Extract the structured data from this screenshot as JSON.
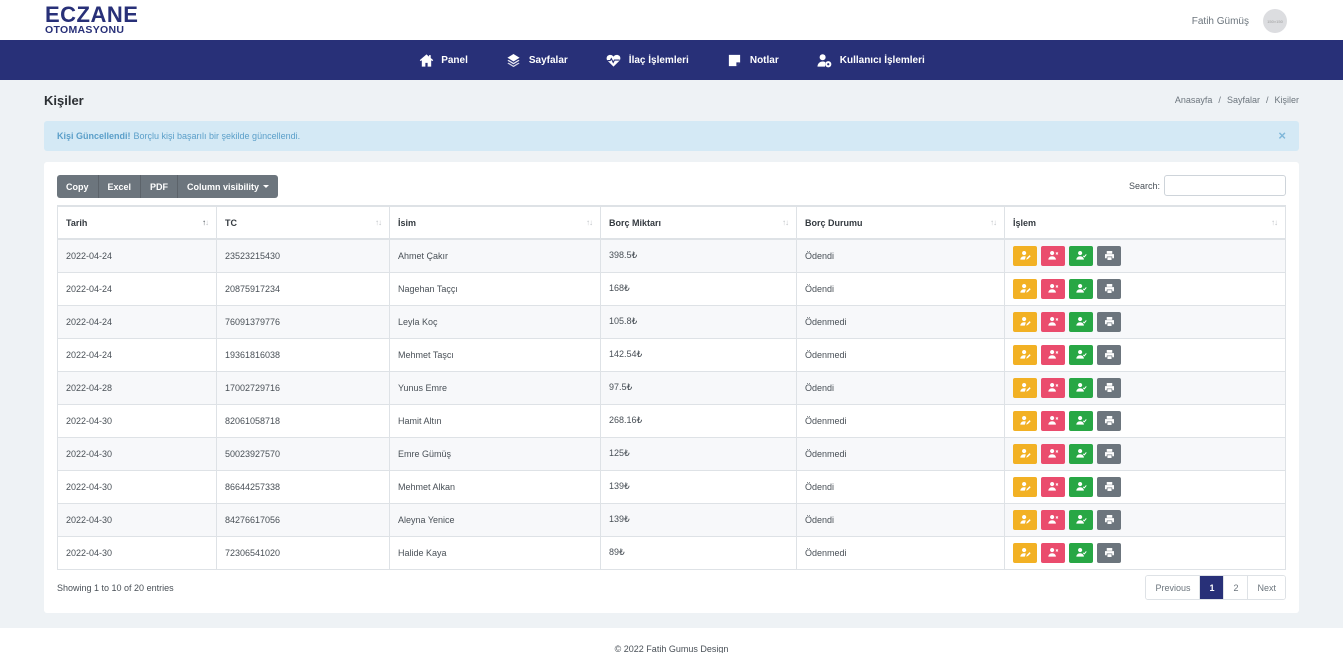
{
  "brand": {
    "name": "ECZANE",
    "subtitle": "OTOMASYONU",
    "color": "#283078"
  },
  "user": {
    "name": "Fatih Gümüş",
    "avatar_text": "150×150"
  },
  "nav": [
    {
      "label": "Panel",
      "icon": "home-icon"
    },
    {
      "label": "Sayfalar",
      "icon": "layers-icon"
    },
    {
      "label": "İlaç İşlemleri",
      "icon": "heart-pulse-icon"
    },
    {
      "label": "Notlar",
      "icon": "sticky-note-icon"
    },
    {
      "label": "Kullanıcı İşlemleri",
      "icon": "user-gear-icon"
    }
  ],
  "page": {
    "title": "Kişiler",
    "breadcrumb": [
      "Anasayfa",
      "Sayfalar",
      "Kişiler"
    ],
    "breadcrumb_sep": "/"
  },
  "alert": {
    "title": "Kişi Güncellendi!",
    "message": "Borçlu kişi başarılı bir şekilde güncellendi.",
    "close": "×"
  },
  "toolbar": {
    "copy": "Copy",
    "excel": "Excel",
    "pdf": "PDF",
    "column_visibility": "Column visibility",
    "search_label": "Search:",
    "search_value": ""
  },
  "table": {
    "columns": [
      "Tarih",
      "TC",
      "İsim",
      "Borç Miktarı",
      "Borç Durumu",
      "İşlem"
    ],
    "sort_glyph": "↑↓",
    "rows": [
      {
        "date": "2022-04-24",
        "tc": "23523215430",
        "name": "Ahmet Çakır",
        "amount": "398.5₺",
        "status": "Ödendi"
      },
      {
        "date": "2022-04-24",
        "tc": "20875917234",
        "name": "Nagehan Taççı",
        "amount": "168₺",
        "status": "Ödendi"
      },
      {
        "date": "2022-04-24",
        "tc": "76091379776",
        "name": "Leyla Koç",
        "amount": "105.8₺",
        "status": "Ödenmedi"
      },
      {
        "date": "2022-04-24",
        "tc": "19361816038",
        "name": "Mehmet Taşcı",
        "amount": "142.54₺",
        "status": "Ödenmedi"
      },
      {
        "date": "2022-04-28",
        "tc": "17002729716",
        "name": "Yunus Emre",
        "amount": "97.5₺",
        "status": "Ödendi"
      },
      {
        "date": "2022-04-30",
        "tc": "82061058718",
        "name": "Hamit Altın",
        "amount": "268.16₺",
        "status": "Ödenmedi"
      },
      {
        "date": "2022-04-30",
        "tc": "50023927570",
        "name": "Emre Gümüş",
        "amount": "125₺",
        "status": "Ödenmedi"
      },
      {
        "date": "2022-04-30",
        "tc": "86644257338",
        "name": "Mehmet Alkan",
        "amount": "139₺",
        "status": "Ödendi"
      },
      {
        "date": "2022-04-30",
        "tc": "84276617056",
        "name": "Aleyna Yenice",
        "amount": "139₺",
        "status": "Ödendi"
      },
      {
        "date": "2022-04-30",
        "tc": "72306541020",
        "name": "Halide Kaya",
        "amount": "89₺",
        "status": "Ödenmedi"
      }
    ],
    "actions": [
      {
        "name": "edit-user-button",
        "icon": "user-edit-icon",
        "color": "#f2b124"
      },
      {
        "name": "delete-user-button",
        "icon": "user-times-icon",
        "color": "#ea4c6d"
      },
      {
        "name": "mark-paid-button",
        "icon": "user-check-icon",
        "color": "#28a745"
      },
      {
        "name": "print-button",
        "icon": "print-icon",
        "color": "#6c757d"
      }
    ]
  },
  "pagination": {
    "info": "Showing 1 to 10 of 20 entries",
    "previous": "Previous",
    "pages": [
      "1",
      "2"
    ],
    "current": "1",
    "next": "Next"
  },
  "footer": {
    "text": "© 2022 Fatih Gumus Design"
  }
}
